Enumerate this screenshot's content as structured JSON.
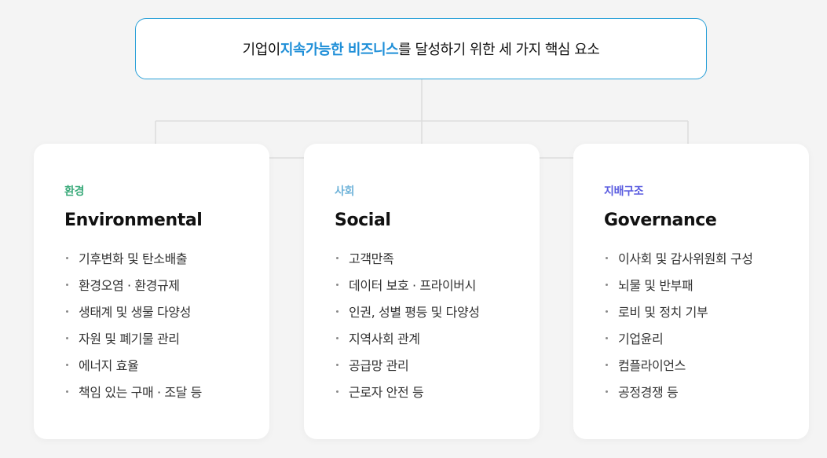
{
  "header": {
    "prefix": "기업이 ",
    "highlight": "지속가능한 비즈니스",
    "suffix": "를 달성하기 위한 세 가지 핵심 요소"
  },
  "colors": {
    "accent_blue": "#1f8fd8",
    "header_border": "#2aa0d8",
    "environmental": "#3aaa7a",
    "social": "#6fb3d9",
    "governance": "#5a5ce0",
    "connector": "#dddddd"
  },
  "cards": [
    {
      "category": "환경",
      "title": "Environmental",
      "items": [
        "기후변화 및 탄소배출",
        "환경오염 · 환경규제",
        "생태계 및 생물 다양성",
        "자원 및 폐기물 관리",
        "에너지 효율",
        "책임 있는 구매 · 조달 등"
      ]
    },
    {
      "category": "사회",
      "title": "Social",
      "items": [
        "고객만족",
        "데이터 보호 · 프라이버시",
        "인권, 성별 평등 및 다양성",
        "지역사회 관계",
        "공급망 관리",
        "근로자 안전 등"
      ]
    },
    {
      "category": "지배구조",
      "title": "Governance",
      "items": [
        "이사회 및 감사위원회 구성",
        "뇌물 및 반부패",
        "로비 및 정치 기부",
        "기업윤리",
        "컴플라이언스",
        "공정경쟁 등"
      ]
    }
  ]
}
